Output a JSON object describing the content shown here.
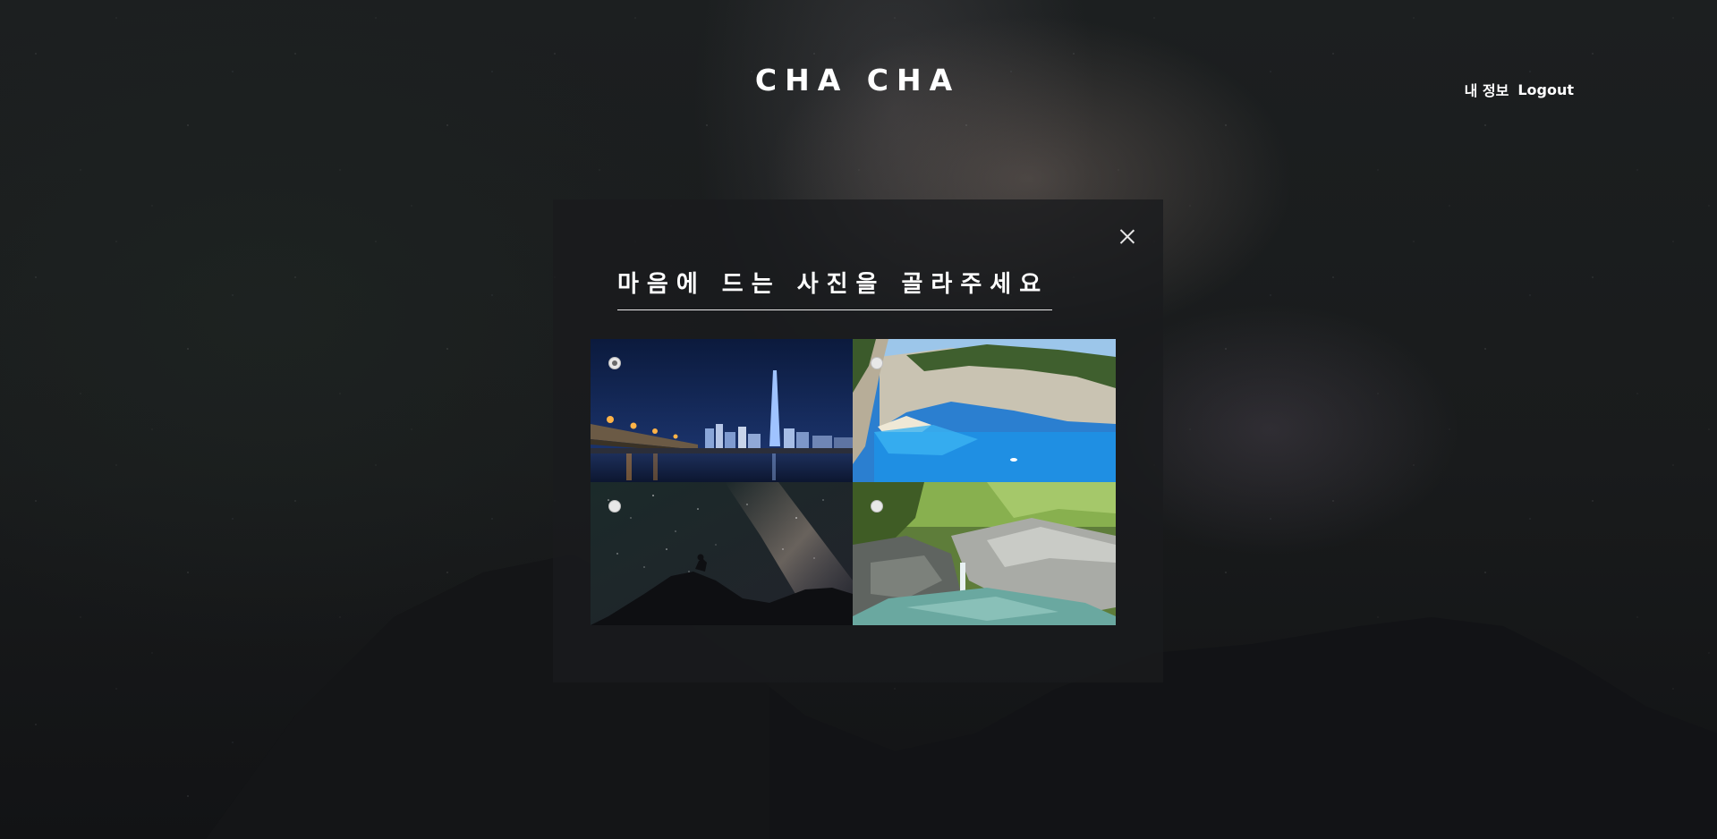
{
  "header": {
    "brand": "CHA CHA",
    "nav": {
      "profile_label": "내 정보",
      "logout_label": "Logout"
    }
  },
  "modal": {
    "title": "마음에 드는 사진을 골라주세요",
    "close_icon": "close-icon",
    "options": [
      {
        "scene": "city-night-bridge",
        "selected": true
      },
      {
        "scene": "beach-cliff-cove",
        "selected": false
      },
      {
        "scene": "starry-sky-silhouette",
        "selected": false
      },
      {
        "scene": "forest-waterfall-stream",
        "selected": false
      }
    ]
  },
  "colors": {
    "background": "#1a1c1e",
    "modal_background": "#1e2023",
    "text": "#ffffff"
  }
}
